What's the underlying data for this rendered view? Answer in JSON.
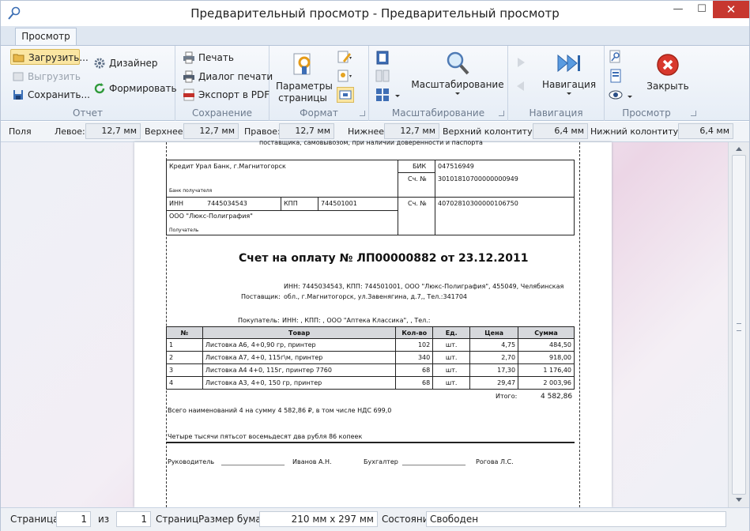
{
  "window": {
    "title": "Предварительный просмотр - Предварительный просмотр",
    "min": "—",
    "max": "☐",
    "close": "✕"
  },
  "tab": {
    "label": "Просмотр"
  },
  "ribbon": {
    "report": {
      "label": "Отчет",
      "load": "Загрузить...",
      "unload": "Выгрузить",
      "save": "Сохранить...",
      "designer": "Дизайнер",
      "build": "Формировать"
    },
    "saving": {
      "label": "Сохранение",
      "print": "Печать",
      "print_dialog": "Диалог печати",
      "export_pdf": "Экспорт в PDF"
    },
    "format": {
      "label": "Формат",
      "page_params": "Параметры страницы"
    },
    "scaling": {
      "label": "Масштабирование",
      "button": "Масштабирование"
    },
    "navigation": {
      "label": "Навигация",
      "button": "Навигация"
    },
    "view": {
      "label": "Просмотр",
      "close": "Закрыть"
    }
  },
  "margins": {
    "fields_label": "Поля",
    "left_label": "Левое:",
    "left": "12,7 мм",
    "top_label": "Верхнее:",
    "top": "12,7 мм",
    "right_label": "Правое:",
    "right": "12,7 мм",
    "bottom_label": "Нижнее:",
    "bottom": "12,7 мм",
    "header_label": "Верхний колонтитул:",
    "header": "6,4 мм",
    "footer_label": "Нижний колонтитул:",
    "footer": "6,4 мм"
  },
  "doc": {
    "top_text": "поставщика, самовывозом, при наличии доверенности и паспорта",
    "bank_name": "Кредит Урал Банк, г.Магнитогорск",
    "bank_recipient": "Банк получателя",
    "bik_label": "БИК",
    "bik": "047516949",
    "corr_label": "Сч. №",
    "corr": "30101810700000000949",
    "inn_label": "ИНН",
    "inn": "7445034543",
    "kpp_label": "КПП",
    "kpp": "744501001",
    "acc_label": "Сч. №",
    "acc": "40702810300000106750",
    "company": "ООО \"Люкс-Полиграфия\"",
    "recipient": "Получатель",
    "invoice_title": "Счет на оплату № ЛП00000882 от 23.12.2011",
    "supplier_label": "Поставщик:",
    "supplier_line1": "ИНН: 7445034543, КПП: 744501001, ООО \"Люкс-Полиграфия\", 455049, Челябинская",
    "supplier_line2": "обл., г.Магнитогорск, ул.Завенягина, д.7,, Тел.:341704",
    "buyer_label": "Покупатель:",
    "buyer": "ИНН: , КПП: , ООО \"Аптека Классика\", , Тел.:",
    "headers": [
      "№",
      "Товар",
      "Кол-во",
      "Ед.",
      "Цена",
      "Сумма"
    ],
    "rows": [
      [
        "1",
        "Листовка А6, 4+0,90 гр, принтер",
        "102",
        "шт.",
        "4,75",
        "484,50"
      ],
      [
        "2",
        "Листовка А7, 4+0, 115г\\м, принтер",
        "340",
        "шт.",
        "2,70",
        "918,00"
      ],
      [
        "3",
        "Листовка А4 4+0, 115г, принтер 7760",
        "68",
        "шт.",
        "17,30",
        "1 176,40"
      ],
      [
        "4",
        "Листовка А3, 4+0, 150 гр, принтер",
        "68",
        "шт.",
        "29,47",
        "2 003,96"
      ]
    ],
    "total_label": "Итого:",
    "total": "4 582,86",
    "summary": "Всего наименований 4 на сумму 4 582,86 ₽, в том числе НДС 699,0",
    "in_words": "Четыре тысячи  пятьсот восемьдесят два рубля 86 копеек",
    "director_label": "Руководитель ",
    "director_line": "____________________",
    "director_name": "Иванов А.Н.",
    "accountant_label": "Бухгалтер",
    "accountant_line": "____________________",
    "accountant_name": "Рогова Л.С."
  },
  "status": {
    "page_label": "Страница:",
    "page": "1",
    "of_label": "из",
    "total": "1",
    "pages_label": "Страниц",
    "paper_label": "Размер бумаги",
    "paper": "210 мм x 297 мм",
    "state_label": "Состояние",
    "state": "Свободен"
  }
}
